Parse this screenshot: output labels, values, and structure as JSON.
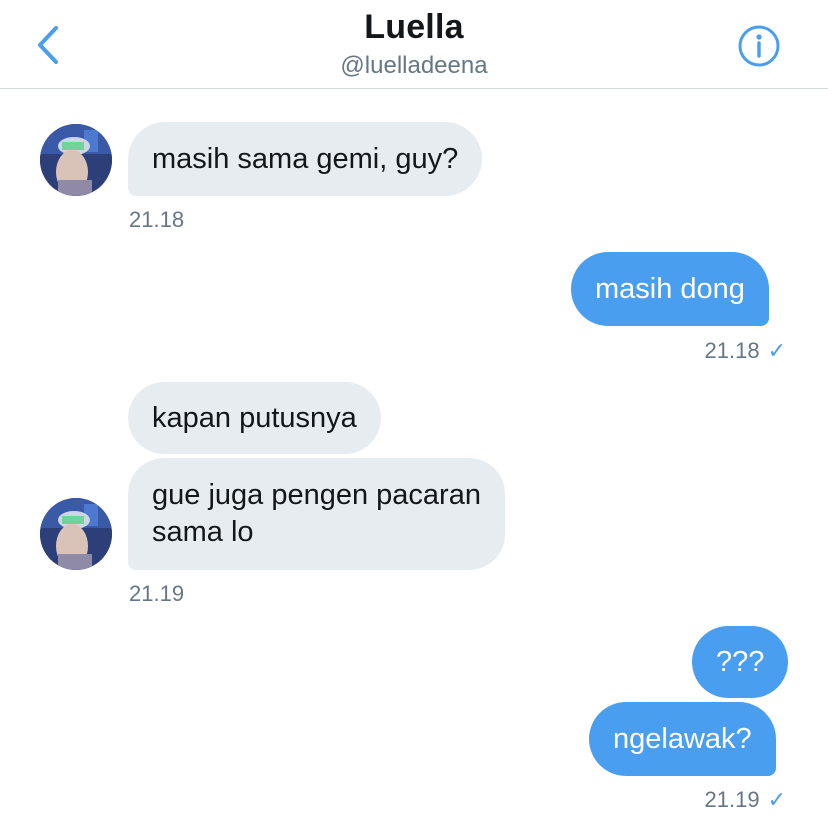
{
  "header": {
    "title": "Luella",
    "handle": "@luelladeena",
    "back_icon": "chevron-left-icon",
    "info_icon": "info-circle-icon"
  },
  "colors": {
    "accent": "#4a9ef0",
    "incoming_bubble": "#e6ecf0",
    "outgoing_bubble": "#4a9ef0",
    "meta_text": "#657786"
  },
  "messages": [
    {
      "text": "masih sama gemi, guy?",
      "direction": "incoming"
    },
    {
      "time": "21.18",
      "direction": "incoming"
    },
    {
      "text": "masih dong",
      "direction": "outgoing"
    },
    {
      "time": "21.18",
      "direction": "outgoing",
      "status": "sent"
    },
    {
      "text": "kapan putusnya",
      "direction": "incoming"
    },
    {
      "text": "gue juga pengen pacaran\nsama lo",
      "direction": "incoming"
    },
    {
      "time": "21.19",
      "direction": "incoming"
    },
    {
      "text": "???",
      "direction": "outgoing"
    },
    {
      "text": "ngelawak?",
      "direction": "outgoing"
    },
    {
      "time": "21.19",
      "direction": "outgoing",
      "status": "sent"
    }
  ],
  "check_glyph": "✓"
}
